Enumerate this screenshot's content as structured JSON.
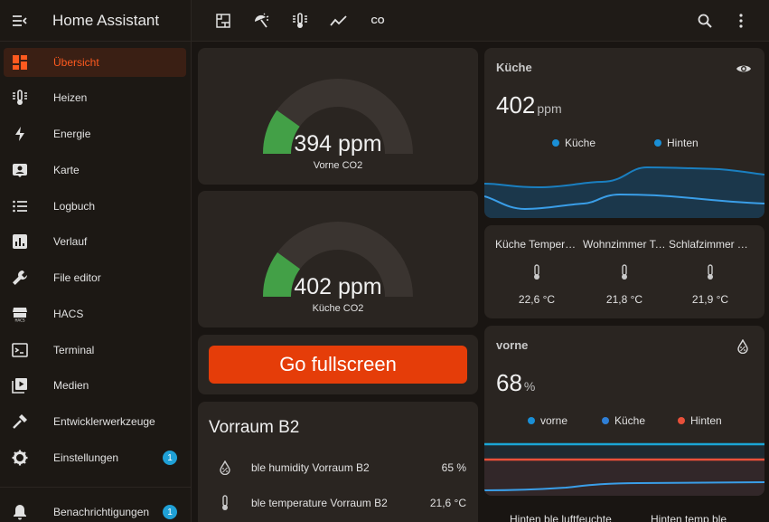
{
  "app": {
    "title": "Home Assistant"
  },
  "sidebar": {
    "items": [
      {
        "label": "Übersicht",
        "icon": "dashboard-icon",
        "active": true
      },
      {
        "label": "Heizen",
        "icon": "thermometer-lines-icon"
      },
      {
        "label": "Energie",
        "icon": "lightning-bolt-icon"
      },
      {
        "label": "Karte",
        "icon": "account-box-icon"
      },
      {
        "label": "Logbuch",
        "icon": "format-list-bulleted-icon"
      },
      {
        "label": "Verlauf",
        "icon": "chart-box-icon"
      },
      {
        "label": "File editor",
        "icon": "wrench-icon"
      },
      {
        "label": "HACS",
        "icon": "hacs-icon"
      },
      {
        "label": "Terminal",
        "icon": "console-icon"
      },
      {
        "label": "Medien",
        "icon": "play-box-multiple-icon"
      },
      {
        "label": "Entwicklerwerkzeuge",
        "icon": "hammer-icon"
      },
      {
        "label": "Einstellungen",
        "icon": "cog-icon",
        "badge": "1"
      }
    ],
    "notifications": {
      "label": "Benachrichtigungen",
      "icon": "bell-icon",
      "badge": "1"
    }
  },
  "toolbar": {
    "views": [
      "floor-plan-icon",
      "weather-icon",
      "thermometer-icon",
      "chart-line-icon",
      "co2-icon"
    ],
    "co2_text": "CO",
    "actions": [
      "search-icon",
      "dots-vertical-icon"
    ]
  },
  "gauges": [
    {
      "value": "394 ppm",
      "name": "Vorne CO2",
      "fraction": 0.197,
      "color": "#43a047"
    },
    {
      "value": "402 ppm",
      "name": "Küche CO2",
      "fraction": 0.201,
      "color": "#43a047"
    }
  ],
  "fullscreen_button": {
    "label": "Go fullscreen",
    "color": "#e53d09"
  },
  "entities_card": {
    "title": "Vorraum B2",
    "rows": [
      {
        "name": "ble humidity Vorraum B2",
        "value": "65 %",
        "icon": "water-percent-icon"
      },
      {
        "name": "ble temperature Vorraum B2",
        "value": "21,6 °C",
        "icon": "thermometer-icon"
      }
    ]
  },
  "kueche_graph": {
    "name": "Küche",
    "value": "402",
    "unit": "ppm",
    "icon": "eye-icon",
    "legend": [
      {
        "name": "Küche",
        "color": "#1a8fd6"
      },
      {
        "name": "Hinten",
        "color": "#1a8fd6"
      }
    ]
  },
  "temperatures": [
    {
      "name": "Küche Temperatur",
      "value": "22,6 °C",
      "icon": "thermometer-icon"
    },
    {
      "name": "Wohnzimmer Temperatur",
      "value": "21,8 °C",
      "icon": "thermometer-icon"
    },
    {
      "name": "Schlafzimmer Temperatur",
      "value": "21,9 °C",
      "icon": "thermometer-icon"
    }
  ],
  "vorne_graph": {
    "name": "vorne",
    "value": "68",
    "unit": "%",
    "icon": "water-percent-icon",
    "legend": [
      {
        "name": "vorne",
        "color": "#1a8fd6"
      },
      {
        "name": "Küche",
        "color": "#2f7fd6"
      },
      {
        "name": "Hinten",
        "color": "#e8503a"
      }
    ]
  },
  "bottom_labels": [
    "Hinten ble luftfeuchte",
    "Hinten temp ble"
  ]
}
